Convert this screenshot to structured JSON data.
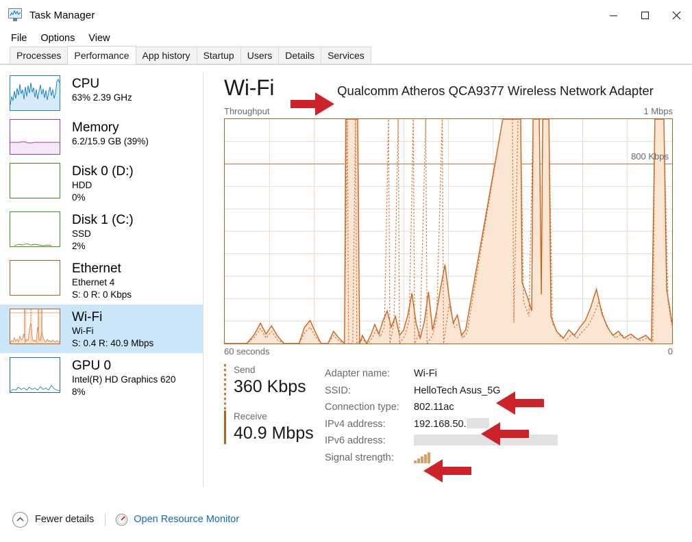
{
  "window": {
    "title": "Task Manager",
    "icon": "task-manager-icon",
    "minimize": "─",
    "maximize": "□",
    "close": "✕"
  },
  "menu": {
    "items": [
      "File",
      "Options",
      "View"
    ]
  },
  "tabs": {
    "items": [
      {
        "label": "Processes",
        "active": false
      },
      {
        "label": "Performance",
        "active": true
      },
      {
        "label": "App history",
        "active": false
      },
      {
        "label": "Startup",
        "active": false
      },
      {
        "label": "Users",
        "active": false
      },
      {
        "label": "Details",
        "active": false
      },
      {
        "label": "Services",
        "active": false
      }
    ]
  },
  "sidebar": {
    "items": [
      {
        "title": "CPU",
        "sub1": "63%  2.39 GHz",
        "sub2": "",
        "color": "#1b84c8",
        "selected": false
      },
      {
        "title": "Memory",
        "sub1": "6.2/15.9 GB (39%)",
        "sub2": "",
        "color": "#9b3fa1",
        "selected": false
      },
      {
        "title": "Disk 0 (D:)",
        "sub1": "HDD",
        "sub2": "0%",
        "color": "#4b8b24",
        "selected": false
      },
      {
        "title": "Disk 1 (C:)",
        "sub1": "SSD",
        "sub2": "2%",
        "color": "#4b8b24",
        "selected": false
      },
      {
        "title": "Ethernet",
        "sub1": "Ethernet 4",
        "sub2": "S: 0 R: 0 Kbps",
        "color": "#b4601e",
        "selected": false
      },
      {
        "title": "Wi-Fi",
        "sub1": "Wi-Fi",
        "sub2": "S: 0.4 R: 40.9 Mbps",
        "color": "#b4601e",
        "selected": true
      },
      {
        "title": "GPU 0",
        "sub1": "Intel(R) HD Graphics 620",
        "sub2": "8%",
        "color": "#1b6e9c",
        "selected": false
      }
    ]
  },
  "main": {
    "title": "Wi-Fi",
    "adapter_name": "Qualcomm Atheros QCA9377 Wireless Network Adapter",
    "graph_top_left_label": "Throughput",
    "graph_top_right_label": "1 Mbps",
    "graph_mid_label": "800 Kbps",
    "graph_bottom_left_label": "60 seconds",
    "graph_bottom_right_label": "0"
  },
  "stats": {
    "send": {
      "label": "Send",
      "value": "360 Kbps"
    },
    "receive": {
      "label": "Receive",
      "value": "40.9 Mbps"
    },
    "info": [
      {
        "key": "Adapter name:",
        "value": "Wi-Fi",
        "type": "text"
      },
      {
        "key": "SSID:",
        "value": "HelloTech Asus_5G",
        "type": "text"
      },
      {
        "key": "Connection type:",
        "value": "802.11ac",
        "type": "text"
      },
      {
        "key": "IPv4 address:",
        "value": "192.168.50.",
        "type": "text-redacted"
      },
      {
        "key": "IPv6 address:",
        "value": "",
        "type": "redacted"
      },
      {
        "key": "Signal strength:",
        "value": "",
        "type": "signal"
      }
    ]
  },
  "footer": {
    "fewer_details": "Fewer details",
    "fewer_details_icon": "chevron-up-circle-icon",
    "resource_monitor": "Open Resource Monitor",
    "resource_monitor_icon": "resource-monitor-icon"
  },
  "annotations": {
    "color": "#cc2229",
    "arrows": [
      {
        "name": "arrow-to-adapter-name",
        "points_to": "Qualcomm Atheros QCA9377 Wireless Network Adapter",
        "direction": "right"
      },
      {
        "name": "arrow-to-ssid",
        "points_to": "HelloTech Asus_5G",
        "direction": "left"
      },
      {
        "name": "arrow-to-ipv4",
        "points_to": "192.168.50.",
        "direction": "left"
      },
      {
        "name": "arrow-to-signal-strength",
        "points_to": "Signal strength",
        "direction": "left"
      }
    ]
  },
  "chart_data": {
    "type": "area",
    "title": "Throughput",
    "ylabel": "Throughput",
    "xlabel": "60 seconds",
    "ylim": [
      0,
      1000
    ],
    "yunit": "Kbps",
    "axis_max_label": "1 Mbps",
    "gridline_label": "800 Kbps",
    "x_left_label": "60 seconds",
    "x_right_label": "0",
    "grid": true,
    "legend": false,
    "line_color": "#c4651f",
    "fill_color": "#fbe6d4",
    "series": [
      {
        "name": "Receive",
        "style": "solid",
        "values": [
          0,
          0,
          0,
          0,
          0,
          0,
          0,
          0,
          0,
          0,
          5,
          60,
          120,
          40,
          90,
          140,
          30,
          0,
          0,
          5,
          70,
          150,
          60,
          10,
          0,
          40,
          80,
          20,
          0,
          0,
          1000,
          1000,
          1000,
          1000,
          1000,
          1000,
          1000,
          220,
          30,
          0,
          60,
          200,
          120,
          40,
          180,
          320,
          200,
          60,
          300,
          620,
          400,
          120,
          60,
          380,
          700,
          420,
          140,
          560,
          980,
          900,
          400,
          120,
          1000,
          1000,
          1000,
          1000,
          700,
          200,
          1000,
          1000,
          1000,
          420,
          180,
          620,
          300,
          120,
          60,
          40,
          120,
          260,
          140,
          60,
          220,
          540,
          340,
          160,
          80,
          40,
          20,
          60,
          40,
          20,
          0,
          0,
          0,
          0,
          1000,
          1000,
          620
        ]
      },
      {
        "name": "Send",
        "style": "dotted",
        "values": [
          0,
          0,
          0,
          0,
          0,
          0,
          0,
          0,
          0,
          0,
          0,
          40,
          90,
          20,
          60,
          110,
          10,
          0,
          0,
          0,
          50,
          120,
          40,
          0,
          0,
          20,
          60,
          10,
          0,
          0,
          1000,
          1000,
          1000,
          1000,
          1000,
          900,
          600,
          120,
          10,
          0,
          30,
          140,
          80,
          20,
          120,
          220,
          140,
          30,
          1000,
          1000,
          1000,
          80,
          30,
          1000,
          1000,
          1000,
          90,
          1000,
          1000,
          600,
          200,
          60,
          1000,
          1000,
          1000,
          1000,
          500,
          120,
          1000,
          1000,
          1000,
          300,
          120,
          400,
          200,
          80,
          30,
          20,
          80,
          180,
          100,
          40,
          140,
          340,
          220,
          100,
          50,
          20,
          10,
          40,
          20,
          10,
          0,
          0,
          0,
          0,
          1000,
          1000,
          400
        ]
      }
    ]
  }
}
